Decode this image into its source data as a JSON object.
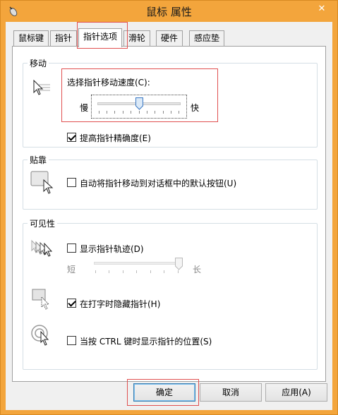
{
  "window": {
    "title": "鼠标 属性",
    "close_glyph": "✕"
  },
  "tabs": [
    {
      "label": "鼠标键"
    },
    {
      "label": "指针"
    },
    {
      "label": "指针选项"
    },
    {
      "label": "滑轮"
    },
    {
      "label": "硬件"
    },
    {
      "label": "感应垫"
    }
  ],
  "motion": {
    "label": "移动",
    "speed_label": "选择指针移动速度(C):",
    "slow": "慢",
    "fast": "快",
    "speed_value_percent": 50,
    "precision_label": "提高指针精确度(E)",
    "precision_checked": true
  },
  "snap": {
    "label": "贴靠",
    "snap_label": "自动将指针移动到对话框中的默认按钮(U)",
    "snap_checked": false
  },
  "visibility": {
    "label": "可见性",
    "trails_label": "显示指针轨迹(D)",
    "trails_checked": false,
    "short": "短",
    "long": "长",
    "trails_value_percent": 100,
    "hide_label": "在打字时隐藏指针(H)",
    "hide_checked": true,
    "ctrl_label": "当按 CTRL 键时显示指针的位置(S)",
    "ctrl_checked": false
  },
  "buttons": {
    "ok": "确定",
    "cancel": "取消",
    "apply": "应用(A)"
  },
  "colors": {
    "titlebar": "#f3a53c",
    "highlight": "#e05050"
  }
}
